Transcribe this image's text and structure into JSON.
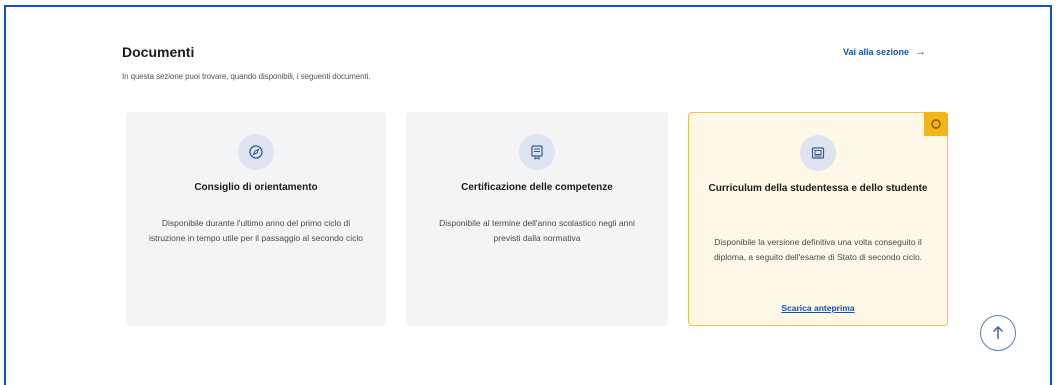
{
  "section": {
    "title": "Documenti",
    "subtitle": "In questa sezione puoi trovare, quando disponibili, i seguenti documenti.",
    "link_label": "Vai alla sezione"
  },
  "cards": [
    {
      "title": "Consiglio di orientamento",
      "description": "Disponibile durante l'ultimo anno del primo ciclo di istruzione in tempo utile per il passaggio al secondo ciclo",
      "icon": "compass-icon"
    },
    {
      "title": "Certificazione delle competenze",
      "description": "Disponibile al termine dell'anno scolastico negli anni previsti dalla normativa",
      "icon": "certificate-icon"
    },
    {
      "title": "Curriculum della studentessa e dello studente",
      "description": "Disponibile la versione definitiva una volta conseguito il diploma, a seguito dell'esame di Stato di secondo ciclo.",
      "link_label": "Scarica anteprima",
      "icon": "curriculum-icon",
      "highlighted": true
    }
  ],
  "colors": {
    "accent": "#0b54c8",
    "highlight_border": "#f0c24a",
    "badge": "#f2b417"
  }
}
